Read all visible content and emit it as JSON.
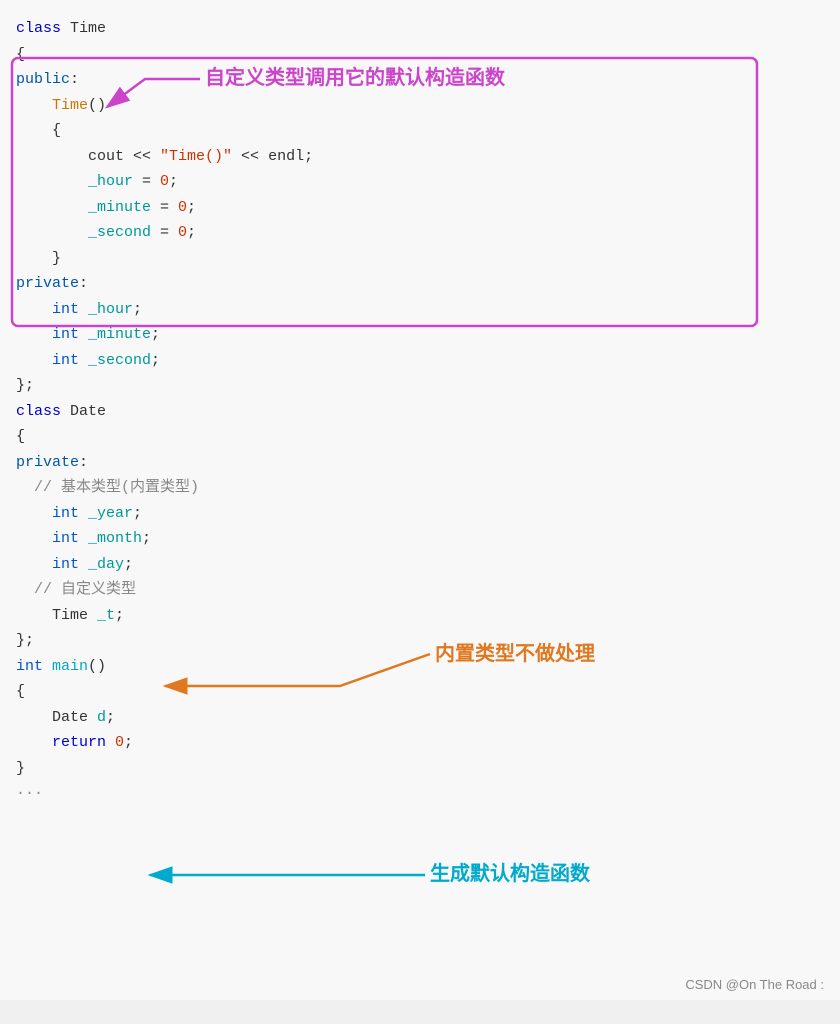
{
  "code": {
    "lines": [
      {
        "id": "l1",
        "indent": 0,
        "tokens": [
          {
            "t": "class ",
            "c": "class-kw"
          },
          {
            "t": "Time",
            "c": "plain"
          }
        ]
      },
      {
        "id": "l2",
        "indent": 0,
        "tokens": [
          {
            "t": "{",
            "c": "plain"
          }
        ]
      },
      {
        "id": "l3",
        "indent": 0,
        "tokens": [
          {
            "t": "public",
            "c": "public-kw"
          },
          {
            "t": ":",
            "c": "plain"
          }
        ]
      },
      {
        "id": "l4",
        "indent": 2,
        "tokens": [
          {
            "t": "Time",
            "c": "fn-name"
          },
          {
            "t": "()",
            "c": "plain"
          }
        ]
      },
      {
        "id": "l5",
        "indent": 2,
        "tokens": [
          {
            "t": "{",
            "c": "plain"
          }
        ]
      },
      {
        "id": "l6",
        "indent": 4,
        "tokens": [
          {
            "t": "cout",
            "c": "plain"
          },
          {
            "t": " << ",
            "c": "plain"
          },
          {
            "t": "\"Time()\"",
            "c": "str"
          },
          {
            "t": " << ",
            "c": "plain"
          },
          {
            "t": "endl",
            "c": "plain"
          },
          {
            "t": ";",
            "c": "plain"
          }
        ]
      },
      {
        "id": "l7",
        "indent": 4,
        "tokens": [
          {
            "t": "_hour",
            "c": "var-name"
          },
          {
            "t": " = ",
            "c": "plain"
          },
          {
            "t": "0",
            "c": "num"
          },
          {
            "t": ";",
            "c": "plain"
          }
        ]
      },
      {
        "id": "l8",
        "indent": 4,
        "tokens": [
          {
            "t": "_minute",
            "c": "var-name"
          },
          {
            "t": " = ",
            "c": "plain"
          },
          {
            "t": "0",
            "c": "num"
          },
          {
            "t": ";",
            "c": "plain"
          }
        ]
      },
      {
        "id": "l9",
        "indent": 4,
        "tokens": [
          {
            "t": "_second",
            "c": "var-name"
          },
          {
            "t": " = ",
            "c": "plain"
          },
          {
            "t": "0",
            "c": "num"
          },
          {
            "t": ";",
            "c": "plain"
          }
        ]
      },
      {
        "id": "l10",
        "indent": 2,
        "tokens": [
          {
            "t": "}",
            "c": "plain"
          }
        ]
      },
      {
        "id": "l11",
        "indent": 0,
        "tokens": [
          {
            "t": "private",
            "c": "private-kw"
          },
          {
            "t": ":",
            "c": "plain"
          }
        ]
      },
      {
        "id": "l12",
        "indent": 2,
        "tokens": [
          {
            "t": "int",
            "c": "type-kw"
          },
          {
            "t": " ",
            "c": "plain"
          },
          {
            "t": "_hour",
            "c": "var-name"
          },
          {
            "t": ";",
            "c": "plain"
          }
        ]
      },
      {
        "id": "l13",
        "indent": 2,
        "tokens": [
          {
            "t": "int",
            "c": "type-kw"
          },
          {
            "t": " ",
            "c": "plain"
          },
          {
            "t": "_minute",
            "c": "var-name"
          },
          {
            "t": ";",
            "c": "plain"
          }
        ]
      },
      {
        "id": "l14",
        "indent": 2,
        "tokens": [
          {
            "t": "int",
            "c": "type-kw"
          },
          {
            "t": " ",
            "c": "plain"
          },
          {
            "t": "_second",
            "c": "var-name"
          },
          {
            "t": ";",
            "c": "plain"
          }
        ]
      },
      {
        "id": "l15",
        "indent": 0,
        "tokens": [
          {
            "t": "};",
            "c": "plain"
          }
        ]
      },
      {
        "id": "l16",
        "indent": 0,
        "tokens": [
          {
            "t": "class ",
            "c": "class-kw"
          },
          {
            "t": "Date",
            "c": "plain"
          }
        ]
      },
      {
        "id": "l17",
        "indent": 0,
        "tokens": [
          {
            "t": "{",
            "c": "plain"
          }
        ]
      },
      {
        "id": "l18",
        "indent": 0,
        "tokens": [
          {
            "t": "private",
            "c": "private-kw"
          },
          {
            "t": ":",
            "c": "plain"
          }
        ]
      },
      {
        "id": "l19",
        "indent": 1,
        "tokens": [
          {
            "t": "// 基本类型(内置类型)",
            "c": "comment"
          }
        ]
      },
      {
        "id": "l20",
        "indent": 2,
        "tokens": [
          {
            "t": "int",
            "c": "type-kw"
          },
          {
            "t": " ",
            "c": "plain"
          },
          {
            "t": "_year",
            "c": "var-name"
          },
          {
            "t": ";",
            "c": "plain"
          }
        ]
      },
      {
        "id": "l21",
        "indent": 2,
        "tokens": [
          {
            "t": "int",
            "c": "type-kw"
          },
          {
            "t": " ",
            "c": "plain"
          },
          {
            "t": "_month",
            "c": "var-name"
          },
          {
            "t": ";",
            "c": "plain"
          }
        ]
      },
      {
        "id": "l22",
        "indent": 2,
        "tokens": [
          {
            "t": "int",
            "c": "type-kw"
          },
          {
            "t": " ",
            "c": "plain"
          },
          {
            "t": "_day",
            "c": "var-name"
          },
          {
            "t": ";",
            "c": "plain"
          }
        ]
      },
      {
        "id": "l23",
        "indent": 1,
        "tokens": [
          {
            "t": "// 自定义类型",
            "c": "comment"
          }
        ]
      },
      {
        "id": "l24",
        "indent": 2,
        "tokens": [
          {
            "t": "Time",
            "c": "plain"
          },
          {
            "t": " ",
            "c": "plain"
          },
          {
            "t": "_t",
            "c": "var-name"
          },
          {
            "t": ";",
            "c": "plain"
          }
        ]
      },
      {
        "id": "l25",
        "indent": 0,
        "tokens": [
          {
            "t": "};",
            "c": "plain"
          }
        ]
      },
      {
        "id": "l26",
        "indent": 0,
        "tokens": [
          {
            "t": "int",
            "c": "type-kw"
          },
          {
            "t": " ",
            "c": "plain"
          },
          {
            "t": "main",
            "c": "fn-blue"
          },
          {
            "t": "()",
            "c": "plain"
          }
        ]
      },
      {
        "id": "l27",
        "indent": 0,
        "tokens": [
          {
            "t": "{",
            "c": "plain"
          }
        ]
      },
      {
        "id": "l28",
        "indent": 2,
        "tokens": [
          {
            "t": "Date",
            "c": "plain"
          },
          {
            "t": " ",
            "c": "plain"
          },
          {
            "t": "d",
            "c": "var-name"
          },
          {
            "t": ";",
            "c": "plain"
          }
        ]
      },
      {
        "id": "l29",
        "indent": 2,
        "tokens": [
          {
            "t": "return ",
            "c": "class-kw"
          },
          {
            "t": "0",
            "c": "num"
          },
          {
            "t": ";",
            "c": "plain"
          }
        ]
      },
      {
        "id": "l30",
        "indent": 0,
        "tokens": [
          {
            "t": "}",
            "c": "plain"
          }
        ]
      },
      {
        "id": "l31",
        "indent": 0,
        "tokens": [
          {
            "t": "···",
            "c": "comment"
          }
        ]
      }
    ],
    "annotations": {
      "annotation1_text": "自定义类型调用它的默认构造函数",
      "annotation2_text": "内置类型不做处理",
      "annotation3_text": "生成默认构造函数"
    },
    "watermark": "CSDN @On The Road :"
  }
}
